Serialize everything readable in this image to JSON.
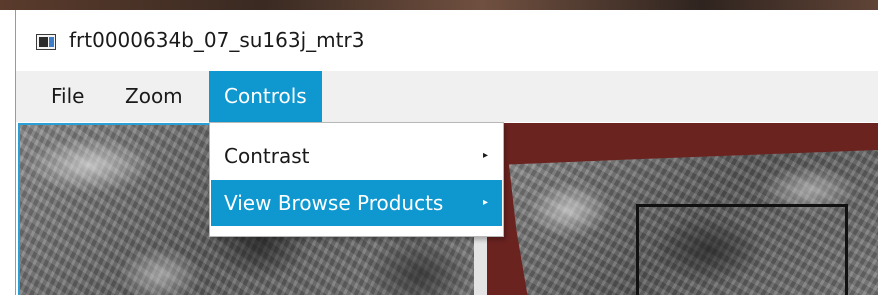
{
  "window": {
    "title": "frt0000634b_07_su163j_mtr3",
    "app_icon": "image-viewer-app-icon"
  },
  "menubar": {
    "items": [
      {
        "label": "File",
        "active": false
      },
      {
        "label": "Zoom",
        "active": false
      },
      {
        "label": "Controls",
        "active": true
      }
    ]
  },
  "controls_menu": {
    "items": [
      {
        "label": "Contrast",
        "submenu_icon": "chevron-right-icon",
        "arrow": "▸",
        "highlighted": false
      },
      {
        "label": "View Browse Products",
        "submenu_icon": "chevron-right-icon",
        "arrow": "▸",
        "highlighted": true
      }
    ]
  },
  "colors": {
    "accent": "#0f98cf",
    "menubar_bg": "#f0f0f0",
    "overview_background": "#6b2320",
    "viewport_box": "#111111"
  }
}
